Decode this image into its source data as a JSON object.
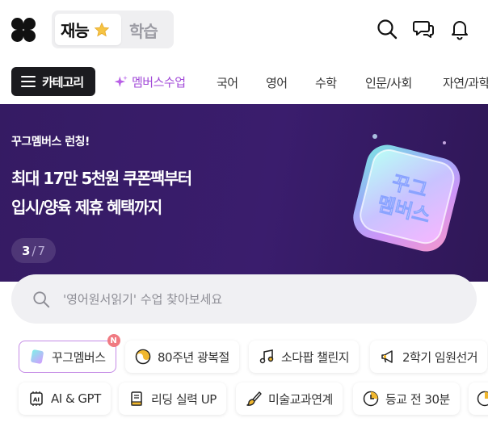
{
  "header": {
    "mode_active_label": "재능",
    "mode_inactive_label": "학습",
    "icons": [
      "search-icon",
      "chat-icon",
      "bell-icon"
    ]
  },
  "nav": {
    "category_button": "카테고리",
    "items": [
      "멤버스수업",
      "국어",
      "영어",
      "수학",
      "인문/사회",
      "자연/과학"
    ]
  },
  "banner": {
    "subtitle": "꾸그멤버스 런칭!",
    "headline_line1": "최대 17만 5천원 쿠폰팩부터",
    "headline_line2": "입시/양육 제휴 혜택까지",
    "counter_current": "3",
    "counter_separator": "/",
    "counter_total": "7",
    "art_text_line1": "꾸그",
    "art_text_line2": "멤버스"
  },
  "search": {
    "placeholder": "'영어원서읽기' 수업 찾아보세요"
  },
  "chips": {
    "row1": [
      {
        "label": "꾸그멤버스",
        "icon": "members-card-icon",
        "badge": "N"
      },
      {
        "label": "80주년 광복절",
        "icon": "taegeuk-icon"
      },
      {
        "label": "소다팝 챌린지",
        "icon": "music-note-icon"
      },
      {
        "label": "2학기 임원선거",
        "icon": "megaphone-icon"
      }
    ],
    "row2": [
      {
        "label": "AI & GPT",
        "icon": "ai-chip-icon"
      },
      {
        "label": "리딩 실력 UP",
        "icon": "book-icon"
      },
      {
        "label": "미술교과연계",
        "icon": "paintbrush-icon"
      },
      {
        "label": "등교 전 30분",
        "icon": "clock-icon"
      }
    ]
  },
  "colors": {
    "banner_bg": "#351b63",
    "accent_purple": "#a24ad8",
    "badge_red": "#f07a82"
  }
}
